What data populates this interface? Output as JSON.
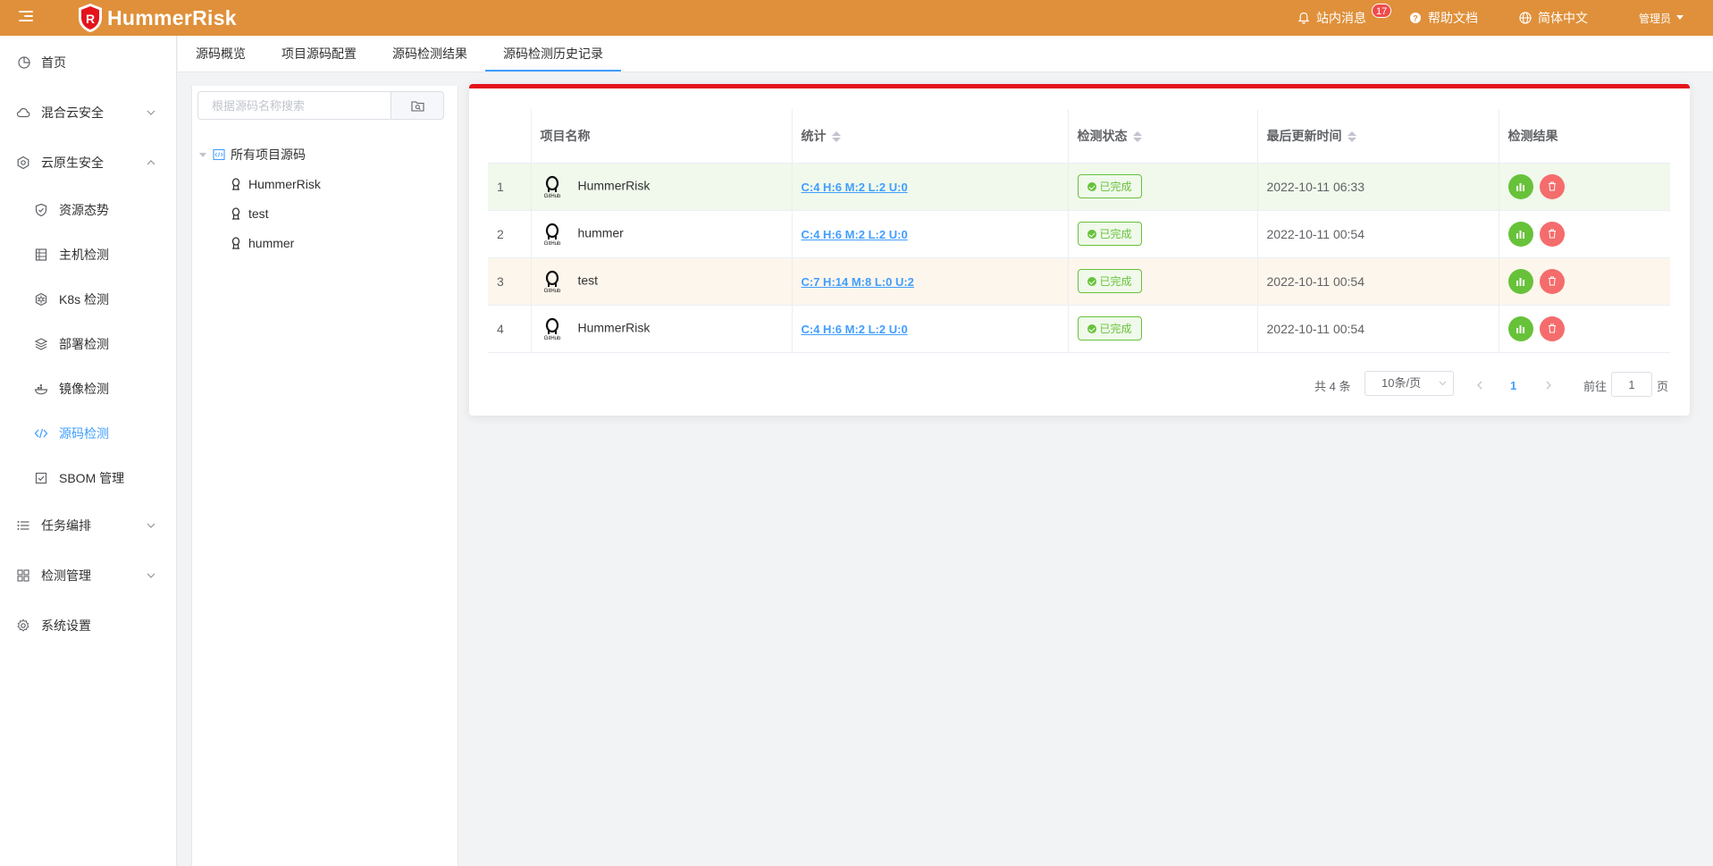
{
  "header": {
    "brand": "HummerRisk",
    "messages_label": "站内消息",
    "messages_count": "17",
    "help_label": "帮助文档",
    "language_label": "简体中文",
    "user_label": "管理员"
  },
  "sidebar": {
    "items": [
      {
        "label": "首页"
      },
      {
        "label": "混合云安全"
      },
      {
        "label": "云原生安全"
      },
      {
        "label": "资源态势"
      },
      {
        "label": "主机检测"
      },
      {
        "label": "K8s 检测"
      },
      {
        "label": "部署检测"
      },
      {
        "label": "镜像检测"
      },
      {
        "label": "源码检测"
      },
      {
        "label": "SBOM 管理"
      },
      {
        "label": "任务编排"
      },
      {
        "label": "检测管理"
      },
      {
        "label": "系统设置"
      }
    ]
  },
  "tabs": [
    "源码概览",
    "项目源码配置",
    "源码检测结果",
    "源码检测历史记录"
  ],
  "tree": {
    "search_placeholder": "根据源码名称搜索",
    "root_label": "所有项目源码",
    "children": [
      "HummerRisk",
      "test",
      "hummer"
    ]
  },
  "table": {
    "columns": [
      "项目名称",
      "统计",
      "检测状态",
      "最后更新时间",
      "检测结果"
    ],
    "rows": [
      {
        "index": "1",
        "name": "HummerRisk",
        "stats": "C:4 H:6 M:2 L:2 U:0",
        "status": "已完成",
        "updated": "2022-10-11 06:33"
      },
      {
        "index": "2",
        "name": "hummer",
        "stats": "C:4 H:6 M:2 L:2 U:0",
        "status": "已完成",
        "updated": "2022-10-11 00:54"
      },
      {
        "index": "3",
        "name": "test",
        "stats": "C:7 H:14 M:8 L:0 U:2",
        "status": "已完成",
        "updated": "2022-10-11 00:54"
      },
      {
        "index": "4",
        "name": "HummerRisk",
        "stats": "C:4 H:6 M:2 L:2 U:0",
        "status": "已完成",
        "updated": "2022-10-11 00:54"
      }
    ]
  },
  "pagination": {
    "total": "共 4 条",
    "page_size": "10条/页",
    "current_page": "1",
    "goto_label": "前往",
    "goto_value": "1",
    "page_suffix": "页"
  },
  "colors": {
    "header_bg": "#e0903a",
    "accent": "#409eff",
    "success": "#67c23a",
    "danger": "#f56c6c",
    "alert_bar": "#e3141c"
  }
}
